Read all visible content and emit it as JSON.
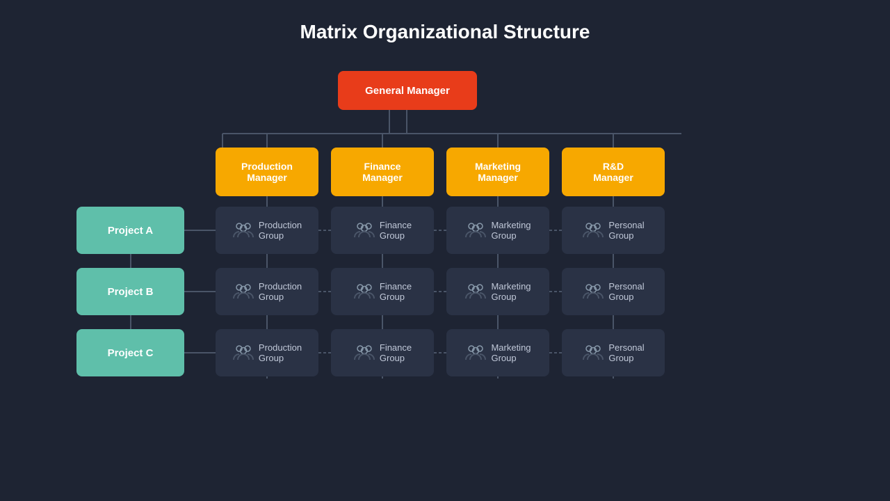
{
  "title": "Matrix Organizational Structure",
  "gm": "General Manager",
  "managers": [
    {
      "id": "pm",
      "label": "Production\nManager"
    },
    {
      "id": "fm",
      "label": "Finance\nManager"
    },
    {
      "id": "mm",
      "label": "Marketing\nManager"
    },
    {
      "id": "rd",
      "label": "R&D\nManager"
    }
  ],
  "projects": [
    {
      "id": "pa",
      "label": "Project A"
    },
    {
      "id": "pb",
      "label": "Project B"
    },
    {
      "id": "pc",
      "label": "Project C"
    }
  ],
  "groups": [
    {
      "label": "Production\nGroup"
    },
    {
      "label": "Finance\nGroup"
    },
    {
      "label": "Marketing\nGroup"
    },
    {
      "label": "Personal\nGroup"
    }
  ],
  "colors": {
    "bg": "#1e2433",
    "gm": "#e83c1a",
    "manager": "#f7a800",
    "project": "#5fbfaa",
    "group": "#2a3245",
    "line": "#4a5568"
  }
}
